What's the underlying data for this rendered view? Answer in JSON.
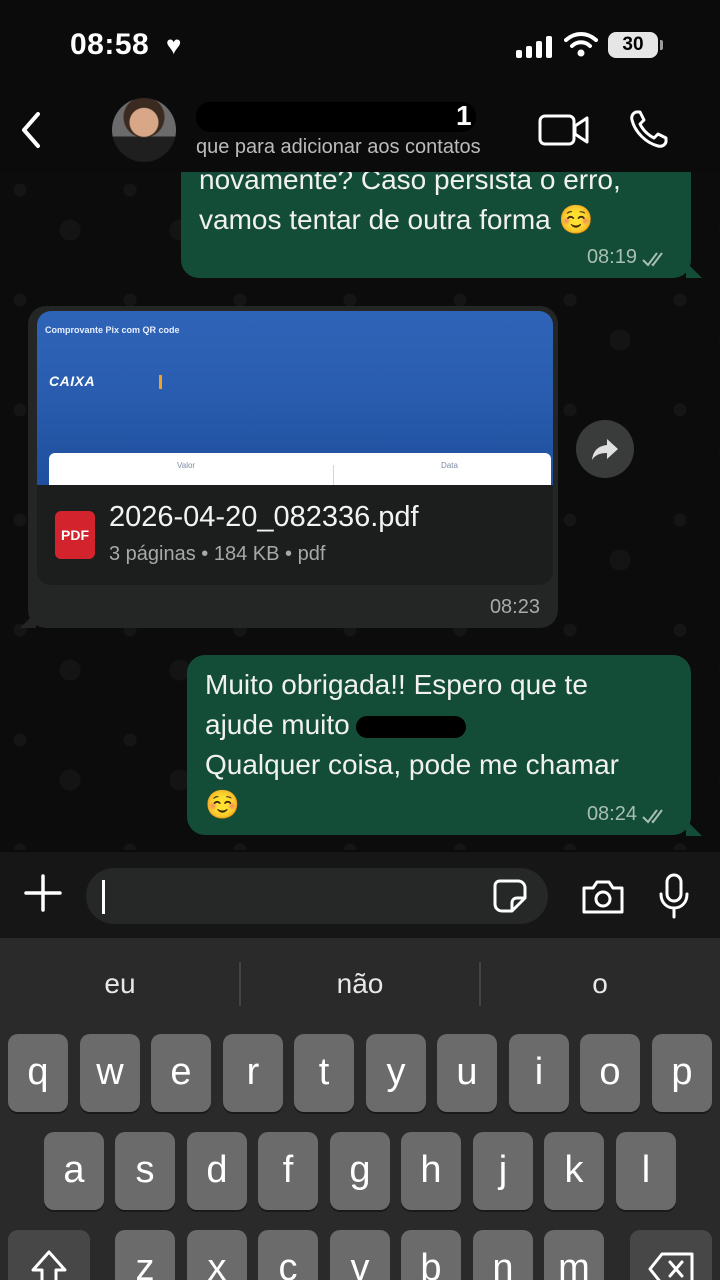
{
  "status_bar": {
    "time": "08:58",
    "battery": "30"
  },
  "header": {
    "contact_name_visible": "1",
    "subtitle": "que para adicionar aos contatos"
  },
  "messages": [
    {
      "direction": "outgoing",
      "lines": [
        "novamente? Caso persista o erro,",
        "vamos tentar de outra forma ☺️"
      ],
      "time": "08:19"
    },
    {
      "direction": "incoming",
      "type": "document",
      "preview": {
        "title": "Comprovante Pix com QR code",
        "logo": "CAIXA",
        "label_left": "Valor",
        "label_right": "Data"
      },
      "file_name": "2026-04-20_082336.pdf",
      "file_info": "3 páginas • 184 KB • pdf",
      "file_badge": "PDF",
      "time": "08:23"
    },
    {
      "direction": "outgoing",
      "lines": [
        "Muito obrigada!! Espero que te",
        "ajude muito",
        "Qualquer coisa, pode me chamar",
        "☺️"
      ],
      "time": "08:24"
    }
  ],
  "composer": {
    "placeholder": ""
  },
  "keyboard": {
    "suggestions": [
      "eu",
      "não",
      "o"
    ],
    "row1": [
      "q",
      "w",
      "e",
      "r",
      "t",
      "y",
      "u",
      "i",
      "o",
      "p"
    ],
    "row2": [
      "a",
      "s",
      "d",
      "f",
      "g",
      "h",
      "j",
      "k",
      "l"
    ],
    "row3": [
      "z",
      "x",
      "c",
      "v",
      "b",
      "n",
      "m"
    ]
  },
  "colors": {
    "outgoing_bubble": "#144d37",
    "incoming_bubble": "#242626",
    "background": "#0b0b0b"
  }
}
